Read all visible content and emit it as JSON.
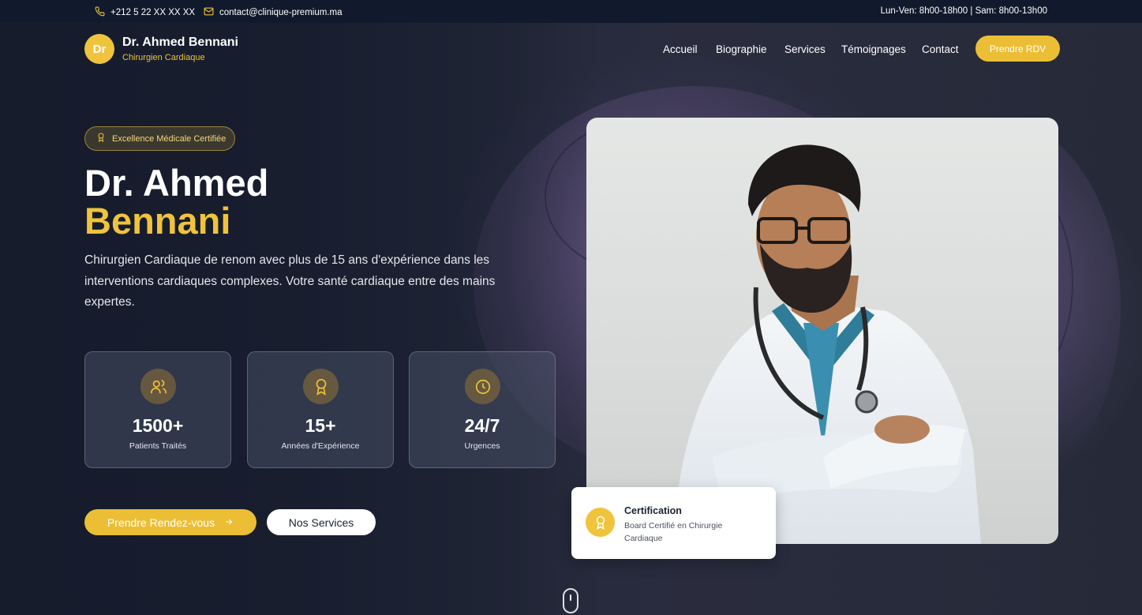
{
  "topbar": {
    "phone": "+212 5 22 XX XX XX",
    "email": "contact@clinique-premium.ma",
    "hours": "Lun-Ven: 8h00-18h00 | Sam: 8h00-13h00"
  },
  "header": {
    "logo_initials": "Dr",
    "name": "Dr. Ahmed Bennani",
    "subtitle": "Chirurgien Cardiaque",
    "nav": [
      "Accueil",
      "Biographie",
      "Services",
      "Témoignages",
      "Contact"
    ],
    "cta": "Prendre RDV"
  },
  "hero": {
    "badge": "Excellence Médicale Certifiée",
    "title_line1": "Dr. Ahmed",
    "title_line2": "Bennani",
    "description": "Chirurgien Cardiaque de renom avec plus de 15 ans d'expérience dans les interventions cardiaques complexes. Votre santé cardiaque entre des mains expertes.",
    "stats": [
      {
        "value": "1500+",
        "label": "Patients Traités",
        "icon": "users-icon"
      },
      {
        "value": "15+",
        "label": "Années d'Expérience",
        "icon": "award-icon"
      },
      {
        "value": "24/7",
        "label": "Urgences",
        "icon": "clock-icon"
      }
    ],
    "primary_cta": "Prendre Rendez-vous",
    "secondary_cta": "Nos Services"
  },
  "certification": {
    "title": "Certification",
    "description": "Board Certifié en Chirurgie Cardiaque"
  },
  "colors": {
    "accent": "#f0c33c",
    "dark": "#111a2c"
  }
}
